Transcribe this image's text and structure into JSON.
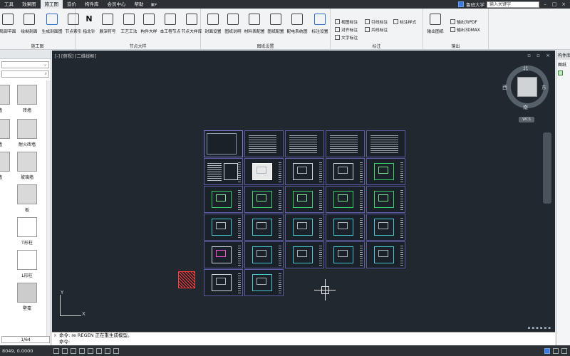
{
  "menu": {
    "items": [
      "工具",
      "效果图",
      "施工图",
      "造价",
      "构件库",
      "会员中心",
      "帮助"
    ],
    "active_index": 2
  },
  "account": {
    "user": "鲁班大学",
    "search_placeholder": "输入关键字"
  },
  "ribbon": {
    "group_construction": {
      "label": "施工图",
      "buttons": [
        "局部平面",
        "绘制剖面",
        "生成剖面图"
      ]
    },
    "group_nodes": {
      "label": "节点大样",
      "buttons": [
        "节点索引",
        "指北针",
        "展深符号",
        "工艺工法",
        "构件大样",
        "本工程节点",
        "节点大样库"
      ]
    },
    "group_sheets": {
      "label": "图纸设置",
      "buttons": [
        "封面设置",
        "图纸说明",
        "材料表配置",
        "图纸配置",
        "配电系统图",
        "标注设置"
      ]
    },
    "group_annotation": {
      "label": "标注",
      "small_buttons": [
        "视图标注",
        "对齐标注",
        "文字标注",
        "引线标注",
        "共线标注",
        "标注样式"
      ]
    },
    "group_output": {
      "label": "输出",
      "buttons": [
        "输出图纸"
      ],
      "small_buttons": [
        "输出为PDF",
        "输出3DMAX"
      ]
    }
  },
  "left_panel": {
    "tiles": [
      "墙",
      "砖墙",
      "墙",
      "耐火砖墙",
      "墙",
      "玻璃墙",
      "板",
      "T形柱",
      "L形柱",
      "壁龛"
    ],
    "pager": "1/64"
  },
  "canvas": {
    "view_label": "[-] [俯视] [二维线框]",
    "compass": {
      "north": "北",
      "south": "南",
      "east": "东",
      "west": "西"
    },
    "wcs": "WCS",
    "axis_x": "X",
    "axis_y": "Y"
  },
  "right_panel": {
    "title": "构件库",
    "tree_label": "图纸"
  },
  "command": {
    "line1": "命令: re REGEN 正在重生成模型。",
    "line2": "命令:"
  },
  "statusbar": {
    "coords": "8049, 0.0000"
  }
}
